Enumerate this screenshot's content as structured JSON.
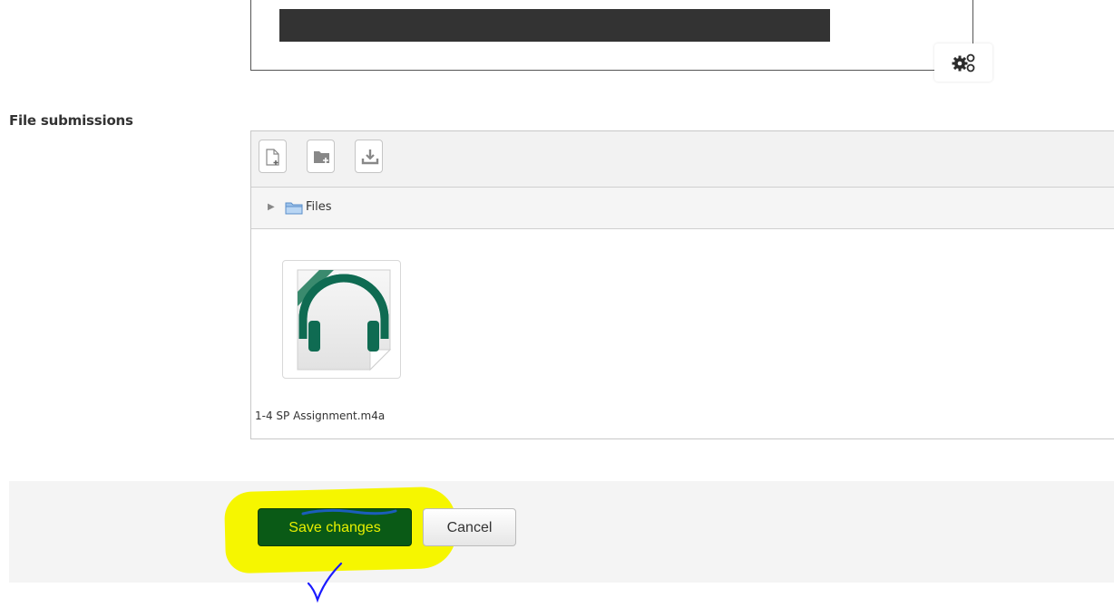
{
  "editor": {
    "settings_icon": "gears-icon"
  },
  "file_submissions": {
    "label": "File submissions",
    "toolbar": {
      "add_file_icon": "add-file-icon",
      "create_folder_icon": "create-folder-icon",
      "download_icon": "download-icon"
    },
    "path": {
      "folder_icon": "folder-icon",
      "label": "Files"
    },
    "files": [
      {
        "name": "1-4 SP Assignment.m4a",
        "icon": "audio-file-icon"
      }
    ]
  },
  "form_actions": {
    "save_label": "Save changes",
    "cancel_label": "Cancel"
  },
  "annotations": {
    "highlight_color": "#f6f600",
    "checkmark_color": "#1a1aff"
  }
}
